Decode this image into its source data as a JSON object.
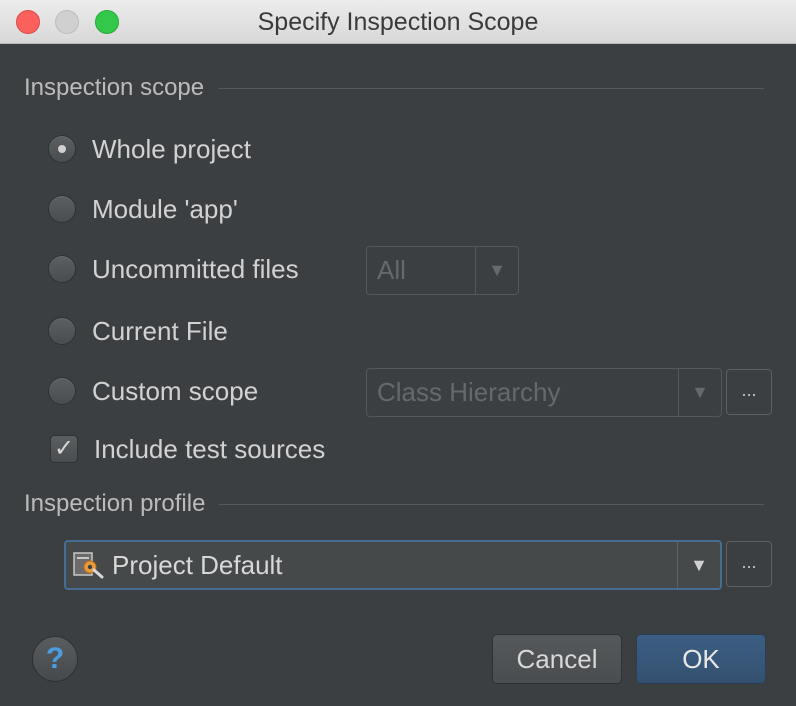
{
  "window": {
    "title": "Specify Inspection Scope"
  },
  "scope": {
    "header": "Inspection scope",
    "options": [
      {
        "label": "Whole project",
        "checked": true
      },
      {
        "label": "Module 'app'",
        "checked": false
      },
      {
        "label": "Uncommitted files",
        "checked": false
      },
      {
        "label": "Current File",
        "checked": false
      },
      {
        "label": "Custom scope",
        "checked": false
      }
    ],
    "uncommitted_combo": {
      "value": "All"
    },
    "custom_scope_combo": {
      "value": "Class Hierarchy"
    },
    "custom_scope_more": "...",
    "include_tests": {
      "label": "Include test sources",
      "checked": true,
      "check_glyph": "✓"
    }
  },
  "profile": {
    "header": "Inspection profile",
    "combo": {
      "value": "Project Default",
      "icon": "inspection-profile-icon"
    },
    "more": "..."
  },
  "buttons": {
    "help": "?",
    "cancel": "Cancel",
    "ok": "OK"
  },
  "colors": {
    "background": "#3c3f41",
    "accent": "#466d94",
    "help_blue": "#4a9de0",
    "ok_button": "#3c5e84"
  }
}
